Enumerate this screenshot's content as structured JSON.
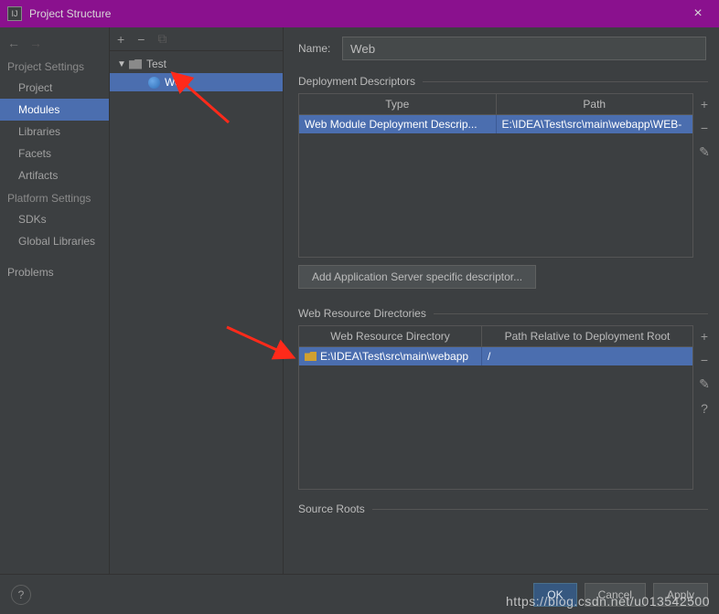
{
  "window": {
    "title": "Project Structure"
  },
  "sidebar": {
    "project_settings_label": "Project Settings",
    "platform_settings_label": "Platform Settings",
    "items": {
      "project": "Project",
      "modules": "Modules",
      "libraries": "Libraries",
      "facets": "Facets",
      "artifacts": "Artifacts",
      "sdks": "SDKs",
      "global_libraries": "Global Libraries",
      "problems": "Problems"
    }
  },
  "tree": {
    "root": "Test",
    "child": "Web"
  },
  "detail": {
    "name_label": "Name:",
    "name_value": "Web",
    "deploy_section": "Deployment Descriptors",
    "deploy_headers": {
      "type": "Type",
      "path": "Path"
    },
    "deploy_row": {
      "type": "Web Module Deployment Descrip...",
      "path": "E:\\IDEA\\Test\\src\\main\\webapp\\WEB-"
    },
    "add_desc_btn": "Add Application Server specific descriptor...",
    "webres_section": "Web Resource Directories",
    "webres_headers": {
      "dir": "Web Resource Directory",
      "rel": "Path Relative to Deployment Root"
    },
    "webres_row": {
      "dir": "E:\\IDEA\\Test\\src\\main\\webapp",
      "rel": "/"
    },
    "source_roots_section": "Source Roots"
  },
  "footer": {
    "ok": "OK",
    "cancel": "Cancel",
    "apply": "Apply"
  },
  "watermark": "https://blog.csdn.net/u013542500"
}
